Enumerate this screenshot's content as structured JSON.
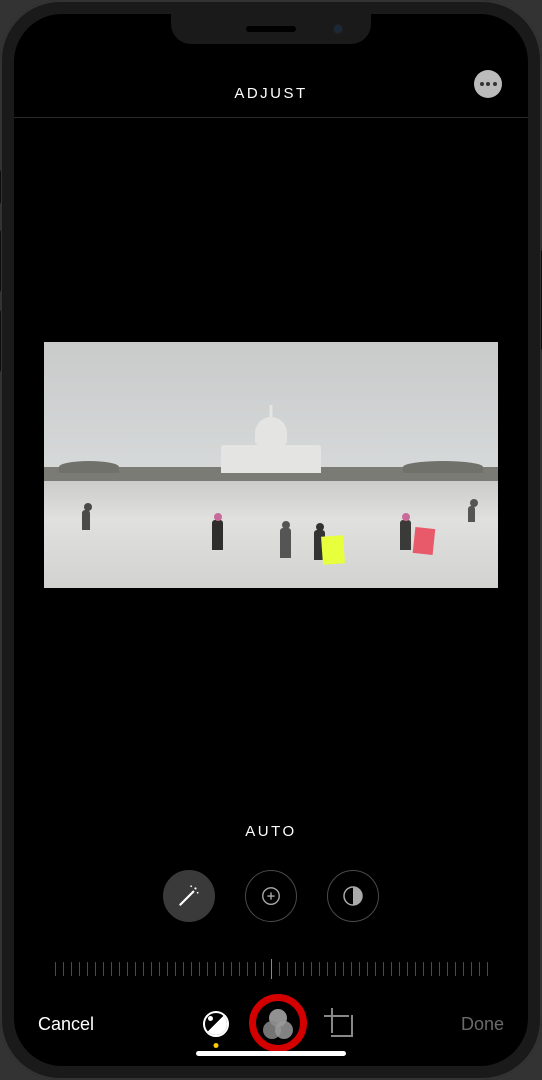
{
  "header": {
    "title": "ADJUST"
  },
  "tool": {
    "current_label": "AUTO"
  },
  "adjustments": [
    {
      "name": "auto",
      "active": true
    },
    {
      "name": "exposure",
      "active": false
    },
    {
      "name": "brilliance",
      "active": false
    }
  ],
  "tabs": {
    "adjust_active": true,
    "filters_highlighted": true
  },
  "actions": {
    "cancel": "Cancel",
    "done": "Done"
  },
  "colors": {
    "highlight": "#d40000",
    "indicator": "#ffcc00"
  }
}
